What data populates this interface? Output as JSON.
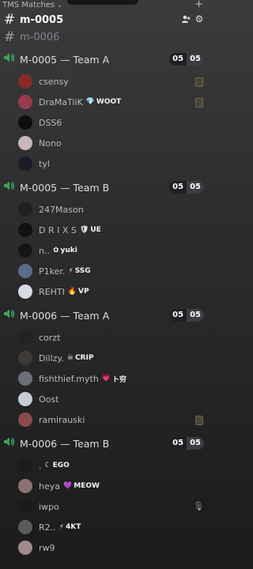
{
  "category": {
    "label": "TMS Matches"
  },
  "colors": {
    "accent": "#3ba55c",
    "text": "#dbdee1",
    "counter_bg": "#1e1f22"
  },
  "text_channels": [
    {
      "name": "m-0005",
      "active": true
    },
    {
      "name": "m-0006",
      "active": false
    }
  ],
  "voice_channels": [
    {
      "name": "M-0005 — Team A",
      "count": "05",
      "limit": "05",
      "users": [
        {
          "name": "csensy",
          "tag": "",
          "avatar": "#8a2a2a",
          "icon": "deafen-bar-icon"
        },
        {
          "name": "DraMaTiiK",
          "tag": "WOOT",
          "tag_icon": "diamond-icon",
          "tag_glyph": "💎",
          "avatar": "#9a3a4a",
          "icon": "deafen-bar-icon"
        },
        {
          "name": "DSS6",
          "tag": "",
          "avatar": "#0e0e0e"
        },
        {
          "name": "Nono",
          "tag": "",
          "avatar": "#c9b7bd"
        },
        {
          "name": "tyl",
          "tag": "",
          "avatar": "#1a1a28"
        }
      ]
    },
    {
      "name": "M-0005 — Team B",
      "count": "05",
      "limit": "05",
      "users": [
        {
          "name": "247Mason",
          "tag": "",
          "avatar": "#202020"
        },
        {
          "name": "D R I X S",
          "tag": "UE",
          "tag_icon": "shield-icon",
          "tag_glyph": "🛡",
          "avatar": "#111111"
        },
        {
          "name": "n..",
          "tag": "yuki",
          "tag_icon": "flower-icon",
          "tag_glyph": "✿",
          "avatar": "#151515"
        },
        {
          "name": "P1ker.",
          "tag": "SSG",
          "tag_icon": "lightning-icon",
          "tag_glyph": "⚡",
          "avatar": "#5b6b88"
        },
        {
          "name": "REHTI",
          "tag": "VP",
          "tag_icon": "fire-icon",
          "tag_glyph": "🔥",
          "avatar": "#d7d9e4"
        }
      ]
    },
    {
      "name": "M-0006 — Team A",
      "count": "05",
      "limit": "05",
      "users": [
        {
          "name": "corzt",
          "tag": "",
          "avatar": "#222222"
        },
        {
          "name": "Dillzy.",
          "tag": "CRIP",
          "tag_icon": "skull-icon",
          "tag_glyph": "☠",
          "avatar": "#403a36"
        },
        {
          "name": "fishthief.myth",
          "tag": "ト穷",
          "tag_icon": "heart-icon",
          "tag_glyph": "💗",
          "avatar": "#6a6f7a"
        },
        {
          "name": "Oost",
          "tag": "",
          "avatar": "#c4ccd8"
        },
        {
          "name": "ramirauski",
          "tag": "",
          "avatar": "#8a4a4a",
          "icon": "deafen-bar-icon"
        }
      ]
    },
    {
      "name": "M-0006 — Team B",
      "count": "05",
      "limit": "05",
      "users": [
        {
          "name": ".",
          "tag": "EGO",
          "tag_icon": "moon-icon",
          "tag_glyph": "☾",
          "avatar": "#1b1b1b"
        },
        {
          "name": "heya",
          "tag": "MEOW",
          "tag_icon": "heart-icon",
          "tag_glyph": "💜",
          "avatar": "#8a7272"
        },
        {
          "name": "iwpo",
          "tag": "",
          "avatar": "#1a1a1a",
          "icon": "muted-mic-icon"
        },
        {
          "name": "R2..",
          "tag": "4KT",
          "tag_icon": "lightning-icon",
          "tag_glyph": "⚡",
          "avatar": "#5a5a5a"
        },
        {
          "name": "rw9",
          "tag": "",
          "avatar": "#a08a8a"
        }
      ]
    }
  ]
}
